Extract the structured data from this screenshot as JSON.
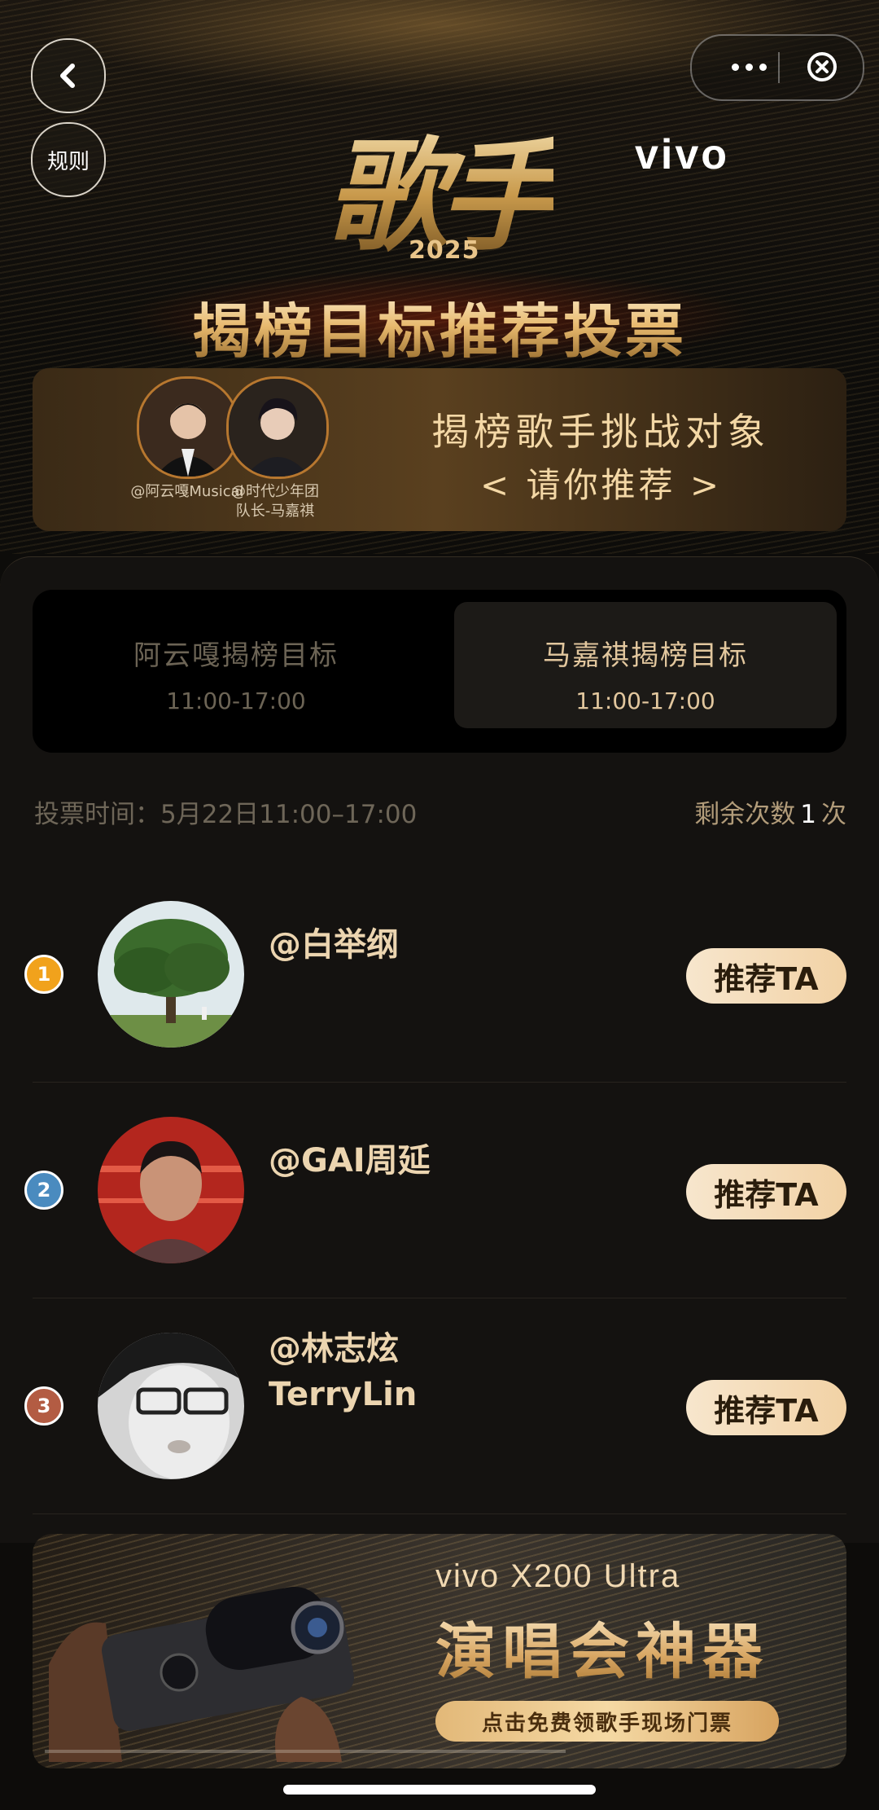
{
  "header": {
    "rules_label": "规则",
    "logo_text": "歌手",
    "logo_year": "2025",
    "brand": "vivo",
    "title": "揭榜目标推荐投票"
  },
  "banner": {
    "guest1": "@阿云嘎Musical",
    "guest2_line1": "@时代少年团",
    "guest2_line2": "队长-马嘉祺",
    "line1": "揭榜歌手挑战对象",
    "line2": "< 请你推荐 >"
  },
  "tabs": [
    {
      "label": "阿云嘎揭榜目标",
      "time": "11:00-17:00"
    },
    {
      "label": "马嘉祺揭榜目标",
      "time": "11:00-17:00"
    }
  ],
  "vote": {
    "time_text": "投票时间：5月22日11:00–17:00",
    "remain_prefix": "剩余次数",
    "remain_count": "1",
    "remain_suffix": "次"
  },
  "candidates": [
    {
      "rank": "1",
      "name": "@白举纲",
      "button": "推荐TA",
      "rank_color": "#f1a21c"
    },
    {
      "rank": "2",
      "name": "@GAI周延",
      "button": "推荐TA",
      "rank_color": "#4a8bbf"
    },
    {
      "rank": "3",
      "name_line1": "@林志炫",
      "name_line2": "TerryLin",
      "button": "推荐TA",
      "rank_color": "#b35c43"
    }
  ],
  "ad": {
    "brand": "vivo X200 Ultra",
    "slogan": "演唱会神器",
    "cta": "点击免费领歌手现场门票"
  }
}
